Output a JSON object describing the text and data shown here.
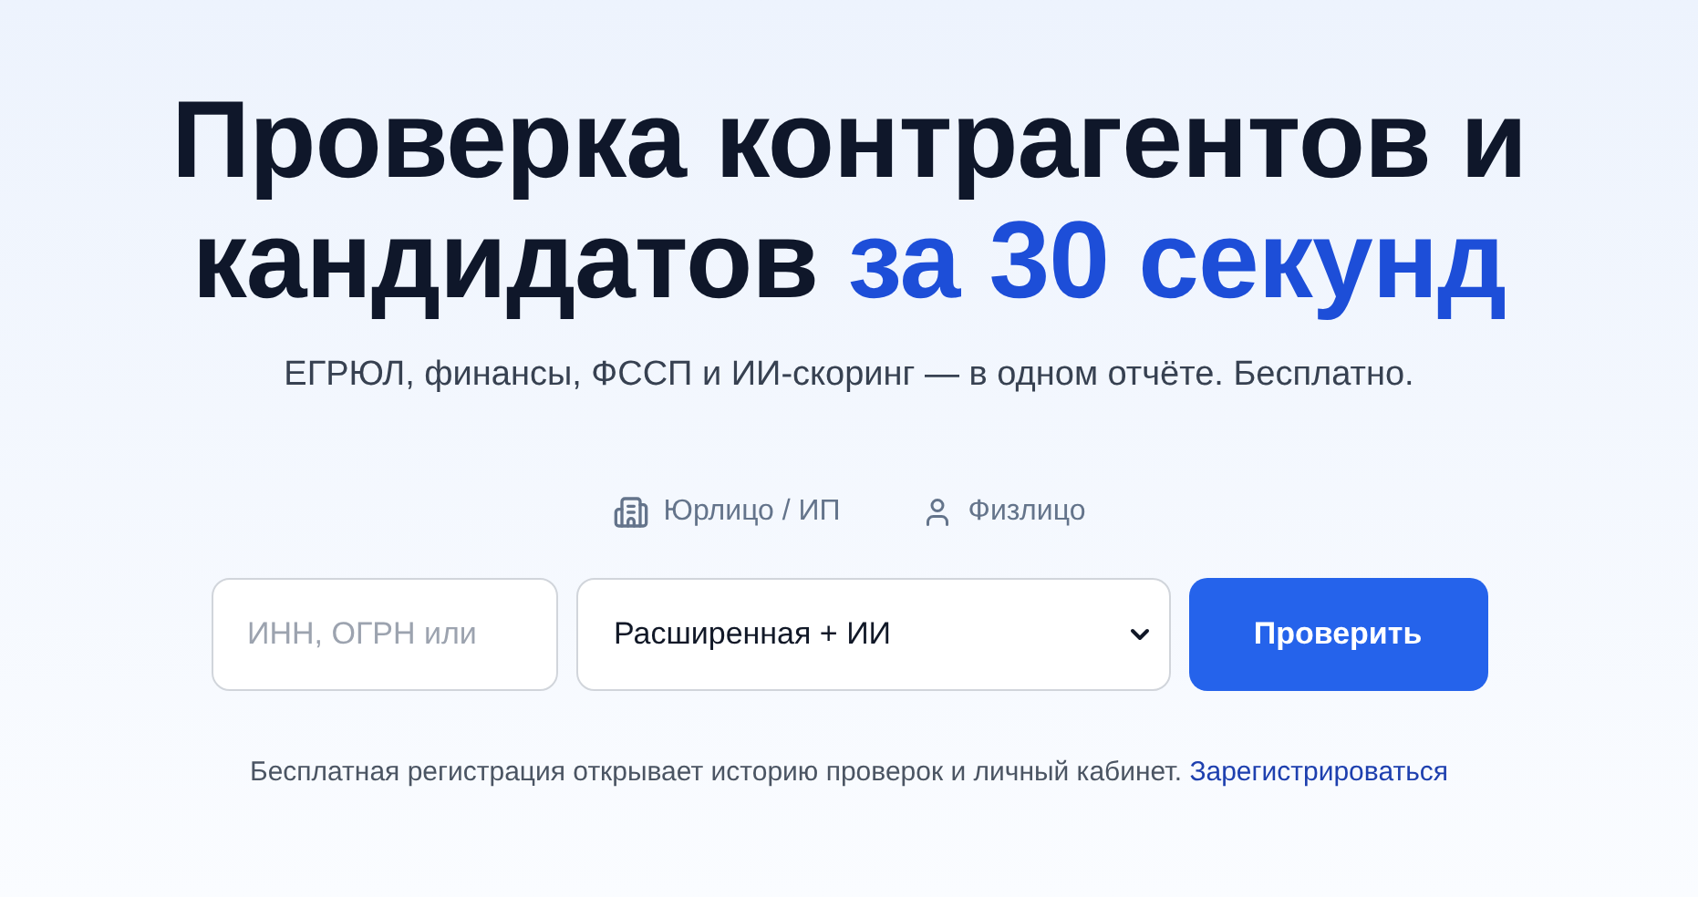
{
  "hero": {
    "title_lines": [
      {
        "parts": [
          {
            "text": "Проверка контрагентов и",
            "accent": false
          }
        ]
      },
      {
        "parts": [
          {
            "text": "кандидатов ",
            "accent": false
          },
          {
            "text": "за 30 секунд",
            "accent": true
          }
        ]
      }
    ],
    "subtitle": "ЕГРЮЛ, финансы, ФССП и ИИ-скоринг — в одном отчёте. Бесплатно."
  },
  "tabs": [
    {
      "label": "Юрлицо / ИП",
      "kind": "company"
    },
    {
      "label": "Физлицо",
      "kind": "person"
    }
  ],
  "search": {
    "placeholder": "ИНН, ОГРН или",
    "select_value": "Расширенная + ИИ",
    "button": "Проверить"
  },
  "footer": {
    "text": "Бесплатная регистрация открывает историю проверок и личный кабинет.",
    "link": "Зарегистрироваться"
  }
}
